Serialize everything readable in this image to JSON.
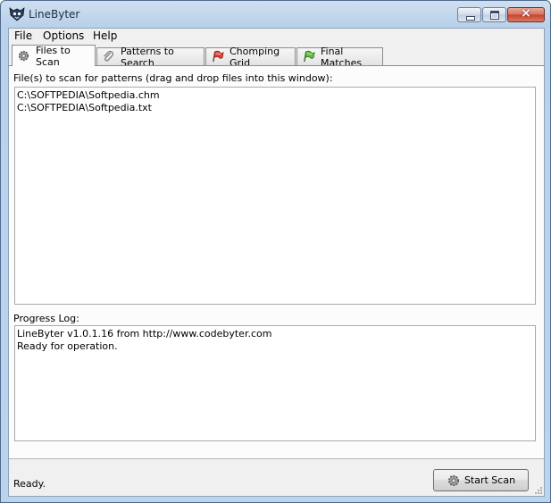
{
  "window": {
    "title": "LineByter",
    "controls": {
      "minimize": "minimize",
      "maximize": "maximize",
      "close": "×"
    }
  },
  "menu": [
    "File",
    "Options",
    "Help"
  ],
  "tabs": [
    {
      "label": "Files to Scan",
      "icon": "gear-icon",
      "active": true
    },
    {
      "label": "Patterns to Search",
      "icon": "paperclip-icon",
      "active": false
    },
    {
      "label": "Chomping Grid",
      "icon": "red-flag-icon",
      "active": false
    },
    {
      "label": "Final Matches",
      "icon": "green-flag-icon",
      "active": false
    }
  ],
  "files_panel": {
    "label": "File(s) to scan for patterns (drag and drop files into this window):",
    "files": [
      "C:\\SOFTPEDIA\\Softpedia.chm",
      "C:\\SOFTPEDIA\\Softpedia.txt"
    ]
  },
  "progress": {
    "label": "Progress Log:",
    "lines": [
      "LineByter v1.0.1.16 from http://www.codebyter.com",
      "Ready for operation."
    ]
  },
  "status_text": "Ready.",
  "start_button": "Start Scan",
  "colors": {
    "title_bar": "#b9d1ea",
    "close_button": "#c7412a",
    "panel": "#fcfcfc"
  }
}
